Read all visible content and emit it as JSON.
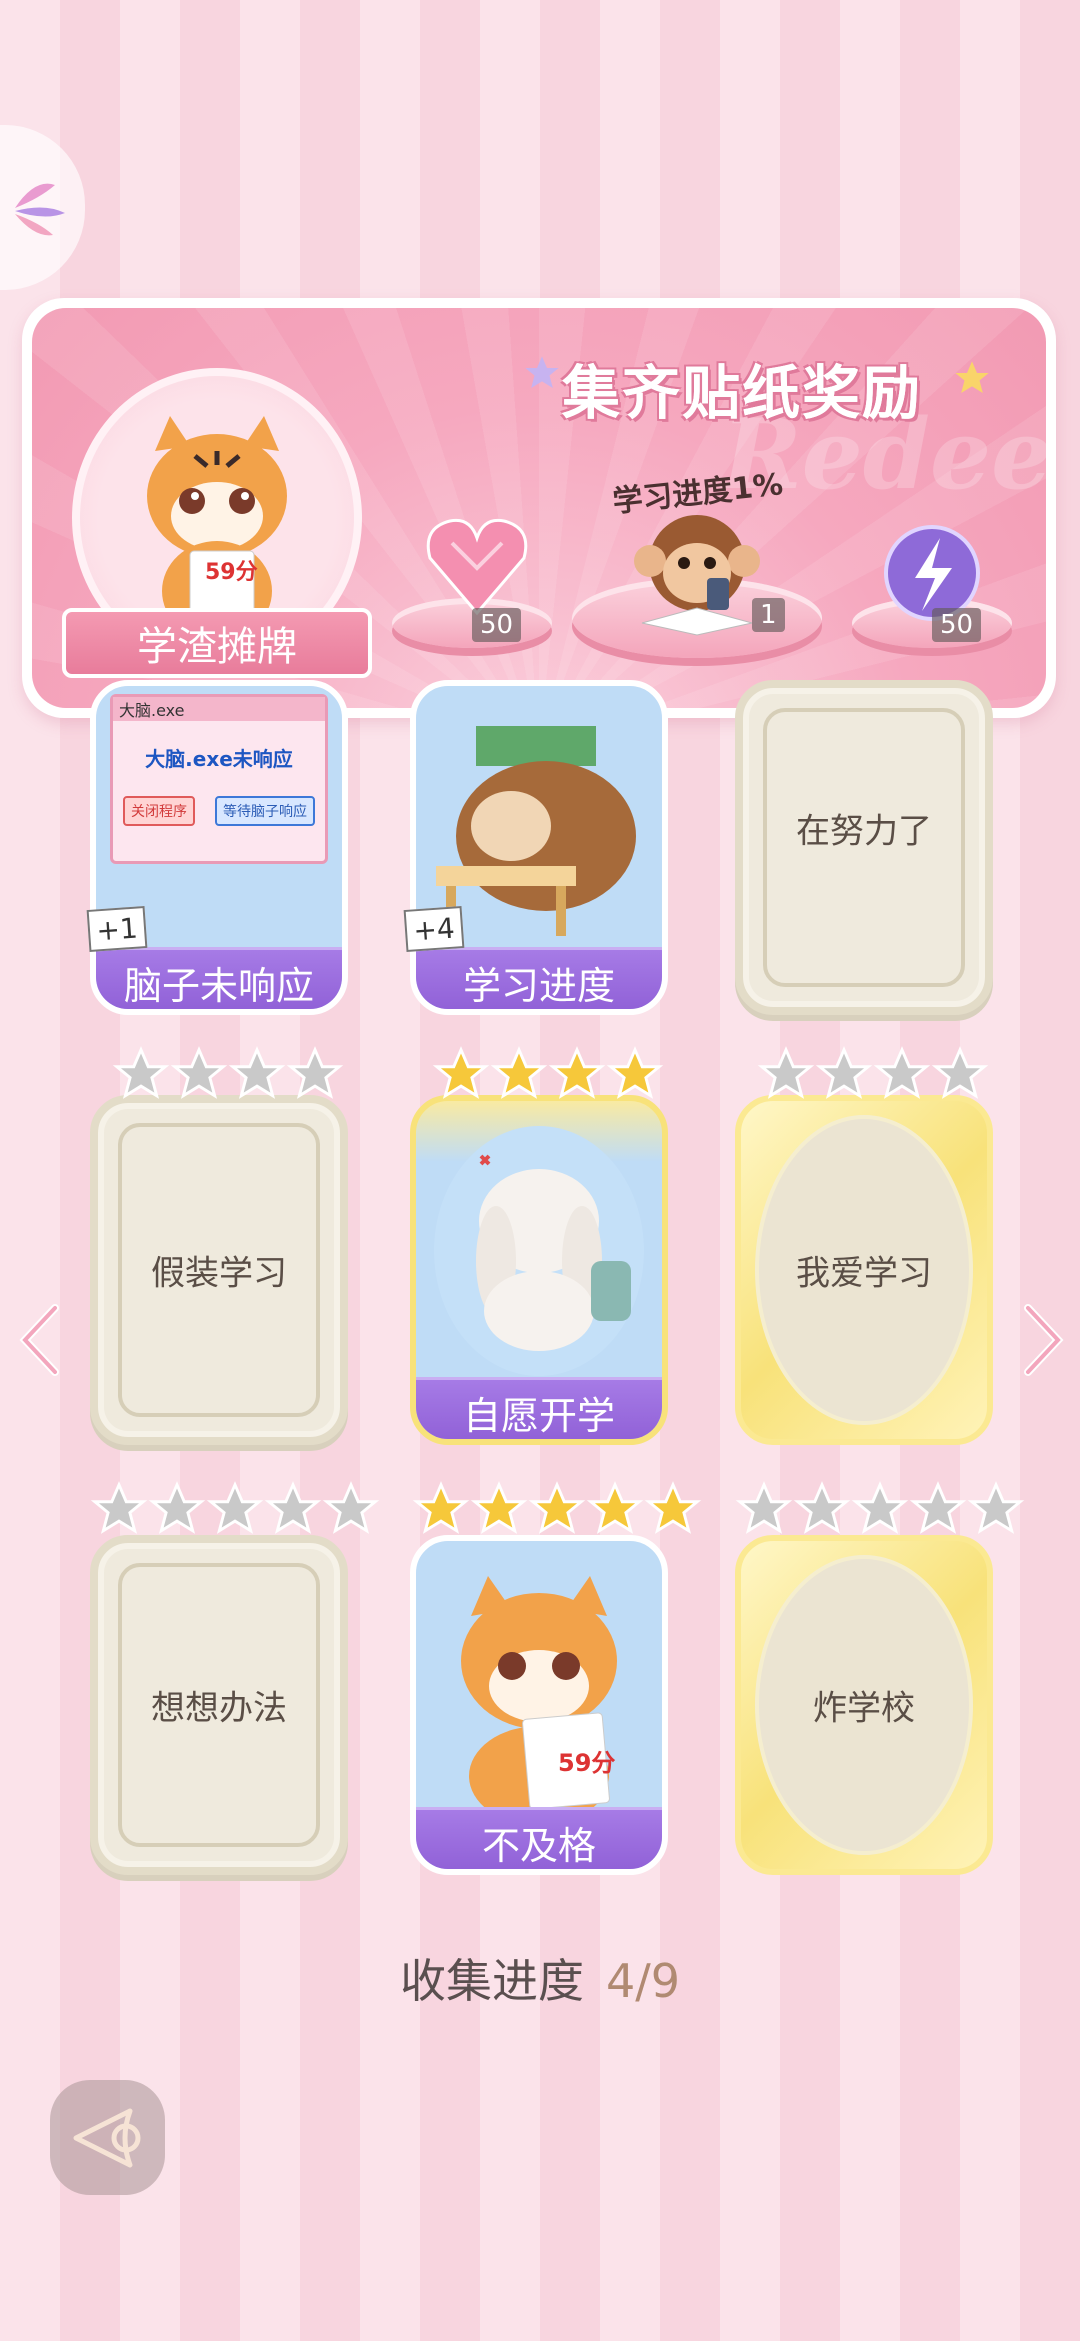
{
  "banner": {
    "title": "集齐贴纸奖励",
    "watermark": "Redeem",
    "name_tag": "学渣摊牌",
    "avatar_paper": "59分",
    "progress_label": "学习进度1%",
    "rewards": [
      {
        "name": "pink-heart-gem",
        "count": "50"
      },
      {
        "name": "monkey-sticker",
        "count": "1"
      },
      {
        "name": "purple-energy-orb",
        "count": "50"
      }
    ]
  },
  "cards": [
    {
      "label": "脑子未响应",
      "state": "owned",
      "dup": "+1",
      "window_title": "大脑.exe",
      "window_msg": "大脑.exe未响应",
      "btn_close": "关闭程序",
      "btn_wait": "等待脑子响应"
    },
    {
      "label": "学习进度",
      "state": "owned",
      "dup": "+4"
    },
    {
      "label": "在努力了",
      "state": "empty"
    },
    {
      "label": "假装学习",
      "state": "empty",
      "stars": 4,
      "filled": 0
    },
    {
      "label": "自愿开学",
      "state": "owned",
      "stars": 4,
      "filled": 4
    },
    {
      "label": "我爱学习",
      "state": "gold-empty",
      "stars": 4,
      "filled": 0
    },
    {
      "label": "想想办法",
      "state": "empty",
      "stars": 5,
      "filled": 0
    },
    {
      "label": "不及格",
      "state": "owned",
      "stars": 5,
      "filled": 5,
      "paper": "59分"
    },
    {
      "label": "炸学校",
      "state": "gold-empty",
      "stars": 5,
      "filled": 0
    }
  ],
  "collection": {
    "label": "收集进度",
    "value": "4/9"
  },
  "colors": {
    "accent_purple": "#9a68dc",
    "star_gold": "#f6c83a",
    "star_grey": "#c9c9c9",
    "pink_bg": "#fbe3ea"
  }
}
